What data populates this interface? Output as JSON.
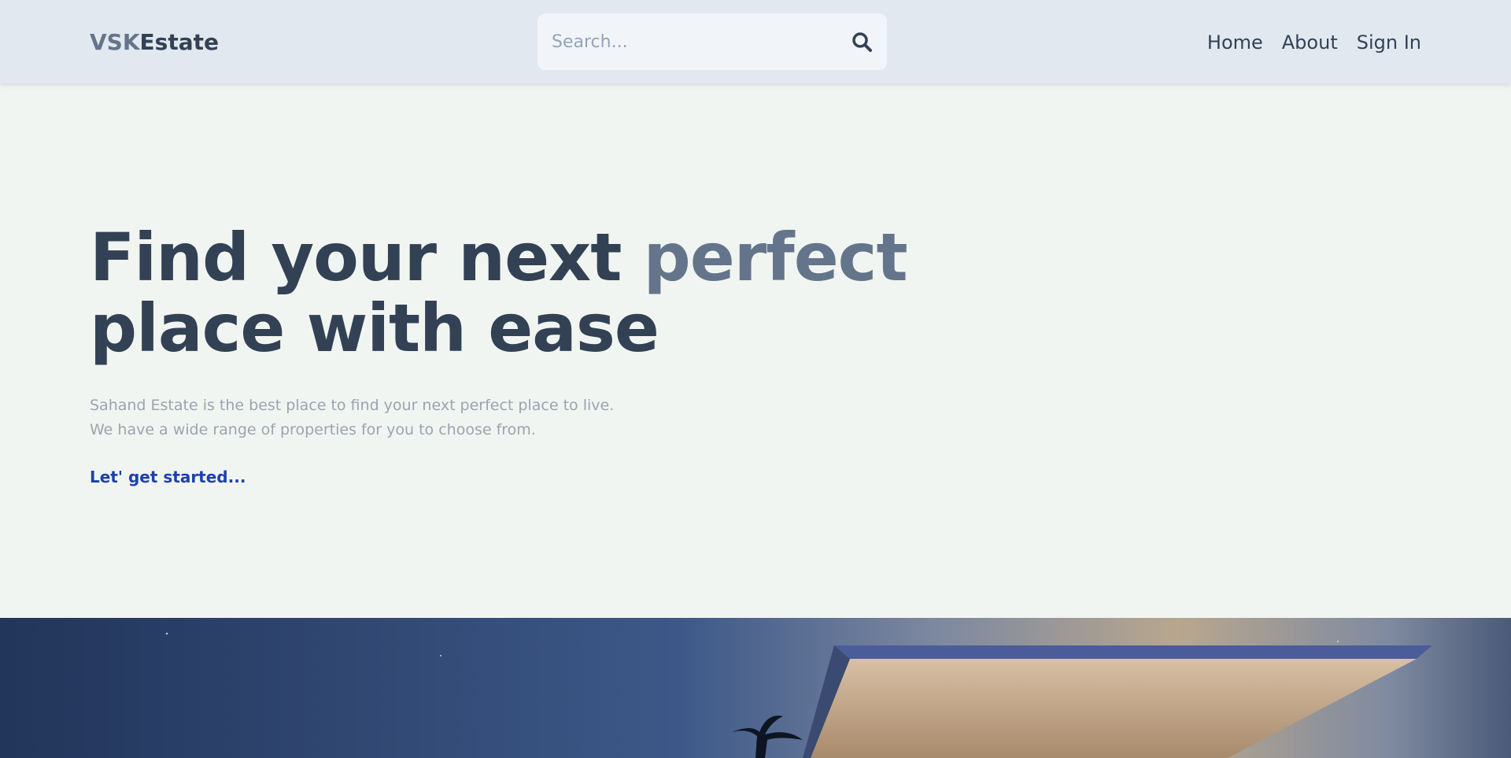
{
  "header": {
    "logo_part1": "VSK",
    "logo_part2": "Estate",
    "search_placeholder": "Search...",
    "search_icon": "search-icon",
    "nav": [
      "Home",
      "About",
      "Sign In"
    ]
  },
  "hero": {
    "headline_part1": "Find your next ",
    "headline_accent": "perfect",
    "headline_part2": "place with ease",
    "description_line1": "Sahand Estate is the best place to find your next perfect place to live.",
    "description_line2": "We have a wide range of properties for you to choose from.",
    "cta": "Let' get started..."
  },
  "colors": {
    "header_bg": "#e2e8f0",
    "page_bg": "#f1f5f1",
    "text_dark": "#334155",
    "text_accent": "#64748b",
    "link": "#1e40af"
  }
}
